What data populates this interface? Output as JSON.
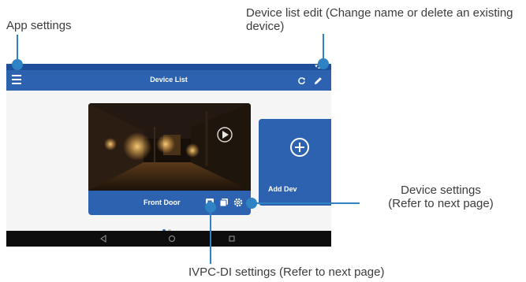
{
  "callouts": {
    "app_settings": "App settings",
    "device_list_edit": "Device list edit (Change name or delete an existing device)",
    "device_settings_line1": "Device settings",
    "device_settings_line2": "(Refer to next page)",
    "ivpc_settings": "IVPC-DI settings (Refer to next page)"
  },
  "app": {
    "title": "Device List",
    "devices": [
      {
        "name": "Front Door"
      }
    ],
    "add_device_label": "Add Dev",
    "page_indicator": {
      "count": 2,
      "active": 0
    }
  },
  "icons": {
    "menu": "hamburger-menu-icon",
    "refresh": "refresh-icon",
    "edit": "pencil-icon",
    "ivpc_settings": "ivpc-settings-icon",
    "device_playback": "playback-icon",
    "device_settings": "gear-icon",
    "add_device": "plus-circle-icon",
    "play": "play-icon",
    "nav_back": "back-icon",
    "nav_home": "home-icon",
    "nav_recent": "recent-apps-icon"
  },
  "colors": {
    "app_bar": "#2d62b0",
    "status_bar": "#1f4f9b",
    "callout_line": "#2f82c4",
    "nav_bar": "#0d0d0d"
  }
}
